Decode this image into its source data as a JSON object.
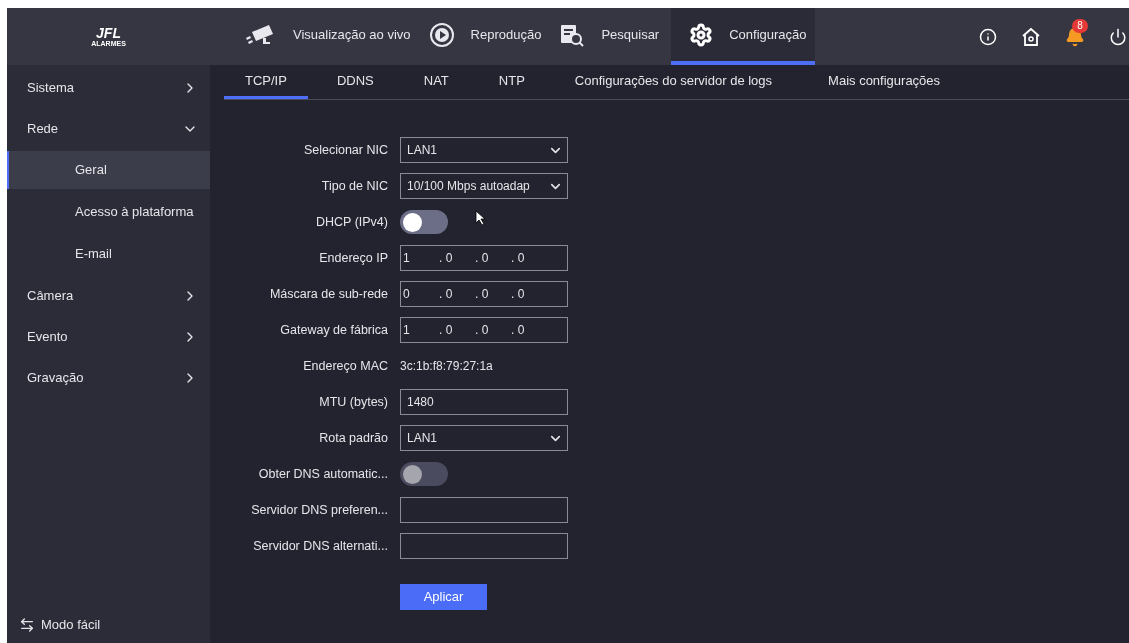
{
  "logo": {
    "mark": "JFL",
    "tagline": "ALARMES"
  },
  "nav": [
    {
      "label": "Visualização ao vivo",
      "selected": false
    },
    {
      "label": "Reprodução",
      "selected": false
    },
    {
      "label": "Pesquisar",
      "selected": false
    },
    {
      "label": "Configuração",
      "selected": true
    }
  ],
  "notifications": {
    "count": "8"
  },
  "sidebar": {
    "items": [
      {
        "label": "Sistema",
        "expanded": false,
        "selected": false
      },
      {
        "label": "Rede",
        "expanded": true,
        "selected": false,
        "children": [
          {
            "label": "Geral",
            "selected": true
          },
          {
            "label": "Acesso à plataforma",
            "selected": false
          },
          {
            "label": "E-mail",
            "selected": false
          }
        ]
      },
      {
        "label": "Câmera",
        "expanded": false,
        "selected": false
      },
      {
        "label": "Evento",
        "expanded": false,
        "selected": false
      },
      {
        "label": "Gravação",
        "expanded": false,
        "selected": false
      }
    ],
    "footer": "Modo fácil"
  },
  "tabs": [
    {
      "label": "TCP/IP",
      "selected": true
    },
    {
      "label": "DDNS",
      "selected": false
    },
    {
      "label": "NAT",
      "selected": false
    },
    {
      "label": "NTP",
      "selected": false
    },
    {
      "label": "Configurações do servidor de logs",
      "selected": false
    },
    {
      "label": "Mais configurações",
      "selected": false
    }
  ],
  "fields": [
    {
      "kind": "select",
      "label": "Selecionar NIC",
      "value": "LAN1"
    },
    {
      "kind": "select",
      "label": "Tipo de NIC",
      "value": "10/100 Mbps autoadap"
    },
    {
      "kind": "toggle",
      "label": "DHCP (IPv4)",
      "on": false,
      "disabled": false
    },
    {
      "kind": "ip",
      "label": "Endereço IP",
      "octets": [
        "1",
        ". 0",
        ". 0",
        ". 0"
      ]
    },
    {
      "kind": "ip",
      "label": "Máscara de sub-rede",
      "octets": [
        "0",
        ". 0",
        ". 0",
        ". 0"
      ]
    },
    {
      "kind": "ip",
      "label": "Gateway de fábrica",
      "octets": [
        "1",
        ". 0",
        ". 0",
        ". 0"
      ]
    },
    {
      "kind": "static",
      "label": "Endereço MAC",
      "value": "3c:1b:f8:79:27:1a"
    },
    {
      "kind": "text",
      "label": "MTU (bytes)",
      "value": "1480"
    },
    {
      "kind": "select",
      "label": "Rota padrão",
      "value": "LAN1"
    },
    {
      "kind": "toggle",
      "label": "Obter DNS automatic...",
      "on": false,
      "disabled": true
    },
    {
      "kind": "text",
      "label": "Servidor DNS preferen..."
    },
    {
      "kind": "text",
      "label": "Servidor DNS alternati..."
    }
  ],
  "apply_button": "Aplicar"
}
